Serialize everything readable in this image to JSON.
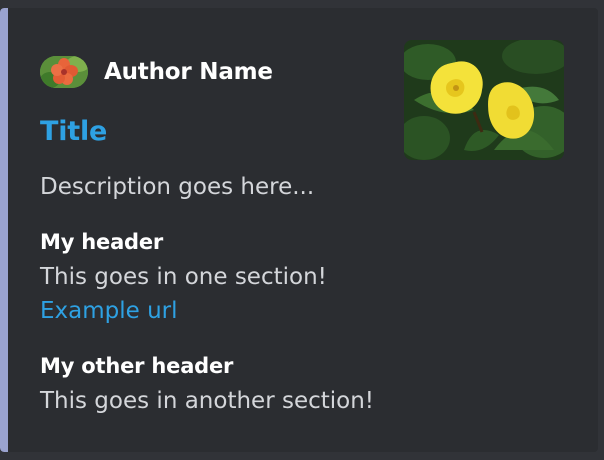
{
  "embed": {
    "accent_color": "#9aa3cf",
    "author": {
      "name": "Author Name",
      "icon": "flower-avatar-icon"
    },
    "title": "Title",
    "description": "Description goes here...",
    "thumbnail": "yellow-flowers-thumbnail",
    "fields": [
      {
        "name": "My header",
        "value": "This goes in one section!",
        "link": "Example url"
      },
      {
        "name": "My other header",
        "value": "This goes in another section!"
      }
    ]
  },
  "colors": {
    "background": "#313338",
    "embed_background": "#2b2d31",
    "link": "#2ea1e3",
    "text": "#d4d6da",
    "heading": "#ffffff"
  }
}
